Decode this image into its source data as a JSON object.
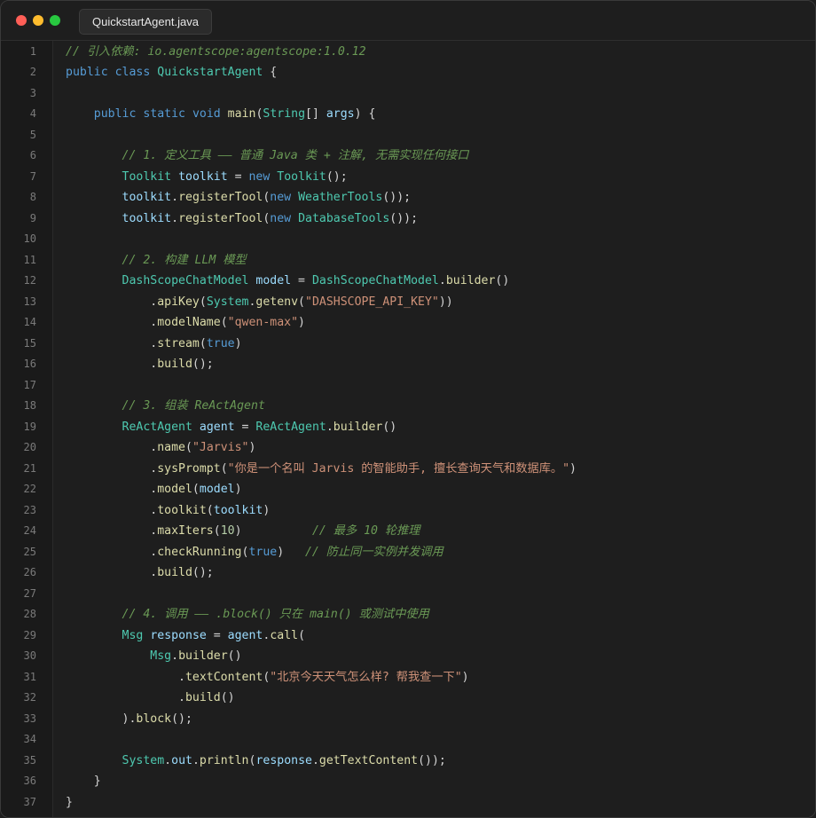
{
  "window": {
    "controls": [
      "close",
      "minimize",
      "zoom"
    ],
    "tab_label": "QuickstartAgent.java"
  },
  "editor": {
    "lines": [
      {
        "n": "1",
        "tokens": [
          {
            "t": "comment",
            "v": "// 引入依赖: io.agentscope:agentscope:1.0.12"
          }
        ]
      },
      {
        "n": "2",
        "tokens": [
          {
            "t": "keyword",
            "v": "public"
          },
          {
            "t": "plain",
            "v": " "
          },
          {
            "t": "keyword",
            "v": "class"
          },
          {
            "t": "plain",
            "v": " "
          },
          {
            "t": "type",
            "v": "QuickstartAgent"
          },
          {
            "t": "plain",
            "v": " {"
          }
        ]
      },
      {
        "n": "3",
        "tokens": []
      },
      {
        "n": "4",
        "tokens": [
          {
            "t": "plain",
            "v": "    "
          },
          {
            "t": "keyword",
            "v": "public"
          },
          {
            "t": "plain",
            "v": " "
          },
          {
            "t": "keyword",
            "v": "static"
          },
          {
            "t": "plain",
            "v": " "
          },
          {
            "t": "keyword",
            "v": "void"
          },
          {
            "t": "plain",
            "v": " "
          },
          {
            "t": "function",
            "v": "main"
          },
          {
            "t": "plain",
            "v": "("
          },
          {
            "t": "type",
            "v": "String"
          },
          {
            "t": "plain",
            "v": "[] "
          },
          {
            "t": "variable",
            "v": "args"
          },
          {
            "t": "plain",
            "v": ") {"
          }
        ]
      },
      {
        "n": "5",
        "tokens": []
      },
      {
        "n": "6",
        "tokens": [
          {
            "t": "plain",
            "v": "        "
          },
          {
            "t": "comment",
            "v": "// 1. 定义工具 —— 普通 Java 类 + 注解, 无需实现任何接口"
          }
        ]
      },
      {
        "n": "7",
        "tokens": [
          {
            "t": "plain",
            "v": "        "
          },
          {
            "t": "type",
            "v": "Toolkit"
          },
          {
            "t": "plain",
            "v": " "
          },
          {
            "t": "variable",
            "v": "toolkit"
          },
          {
            "t": "plain",
            "v": " = "
          },
          {
            "t": "keyword",
            "v": "new"
          },
          {
            "t": "plain",
            "v": " "
          },
          {
            "t": "type",
            "v": "Toolkit"
          },
          {
            "t": "plain",
            "v": "();"
          }
        ]
      },
      {
        "n": "8",
        "tokens": [
          {
            "t": "plain",
            "v": "        "
          },
          {
            "t": "variable",
            "v": "toolkit"
          },
          {
            "t": "plain",
            "v": "."
          },
          {
            "t": "function",
            "v": "registerTool"
          },
          {
            "t": "plain",
            "v": "("
          },
          {
            "t": "keyword",
            "v": "new"
          },
          {
            "t": "plain",
            "v": " "
          },
          {
            "t": "type",
            "v": "WeatherTools"
          },
          {
            "t": "plain",
            "v": "());"
          }
        ]
      },
      {
        "n": "9",
        "tokens": [
          {
            "t": "plain",
            "v": "        "
          },
          {
            "t": "variable",
            "v": "toolkit"
          },
          {
            "t": "plain",
            "v": "."
          },
          {
            "t": "function",
            "v": "registerTool"
          },
          {
            "t": "plain",
            "v": "("
          },
          {
            "t": "keyword",
            "v": "new"
          },
          {
            "t": "plain",
            "v": " "
          },
          {
            "t": "type",
            "v": "DatabaseTools"
          },
          {
            "t": "plain",
            "v": "());"
          }
        ]
      },
      {
        "n": "10",
        "tokens": []
      },
      {
        "n": "11",
        "tokens": [
          {
            "t": "plain",
            "v": "        "
          },
          {
            "t": "comment",
            "v": "// 2. 构建 LLM 模型"
          }
        ]
      },
      {
        "n": "12",
        "tokens": [
          {
            "t": "plain",
            "v": "        "
          },
          {
            "t": "type",
            "v": "DashScopeChatModel"
          },
          {
            "t": "plain",
            "v": " "
          },
          {
            "t": "variable",
            "v": "model"
          },
          {
            "t": "plain",
            "v": " = "
          },
          {
            "t": "type",
            "v": "DashScopeChatModel"
          },
          {
            "t": "plain",
            "v": "."
          },
          {
            "t": "function",
            "v": "builder"
          },
          {
            "t": "plain",
            "v": "()"
          }
        ]
      },
      {
        "n": "13",
        "tokens": [
          {
            "t": "plain",
            "v": "            ."
          },
          {
            "t": "function",
            "v": "apiKey"
          },
          {
            "t": "plain",
            "v": "("
          },
          {
            "t": "type",
            "v": "System"
          },
          {
            "t": "plain",
            "v": "."
          },
          {
            "t": "function",
            "v": "getenv"
          },
          {
            "t": "plain",
            "v": "("
          },
          {
            "t": "string",
            "v": "\"DASHSCOPE_API_KEY\""
          },
          {
            "t": "plain",
            "v": "))"
          }
        ]
      },
      {
        "n": "14",
        "tokens": [
          {
            "t": "plain",
            "v": "            ."
          },
          {
            "t": "function",
            "v": "modelName"
          },
          {
            "t": "plain",
            "v": "("
          },
          {
            "t": "string",
            "v": "\"qwen-max\""
          },
          {
            "t": "plain",
            "v": ")"
          }
        ]
      },
      {
        "n": "15",
        "tokens": [
          {
            "t": "plain",
            "v": "            ."
          },
          {
            "t": "function",
            "v": "stream"
          },
          {
            "t": "plain",
            "v": "("
          },
          {
            "t": "keyword",
            "v": "true"
          },
          {
            "t": "plain",
            "v": ")"
          }
        ]
      },
      {
        "n": "16",
        "tokens": [
          {
            "t": "plain",
            "v": "            ."
          },
          {
            "t": "function",
            "v": "build"
          },
          {
            "t": "plain",
            "v": "();"
          }
        ]
      },
      {
        "n": "17",
        "tokens": []
      },
      {
        "n": "18",
        "tokens": [
          {
            "t": "plain",
            "v": "        "
          },
          {
            "t": "comment",
            "v": "// 3. 组装 ReActAgent"
          }
        ]
      },
      {
        "n": "19",
        "tokens": [
          {
            "t": "plain",
            "v": "        "
          },
          {
            "t": "type",
            "v": "ReActAgent"
          },
          {
            "t": "plain",
            "v": " "
          },
          {
            "t": "variable",
            "v": "agent"
          },
          {
            "t": "plain",
            "v": " = "
          },
          {
            "t": "type",
            "v": "ReActAgent"
          },
          {
            "t": "plain",
            "v": "."
          },
          {
            "t": "function",
            "v": "builder"
          },
          {
            "t": "plain",
            "v": "()"
          }
        ]
      },
      {
        "n": "20",
        "tokens": [
          {
            "t": "plain",
            "v": "            ."
          },
          {
            "t": "function",
            "v": "name"
          },
          {
            "t": "plain",
            "v": "("
          },
          {
            "t": "string",
            "v": "\"Jarvis\""
          },
          {
            "t": "plain",
            "v": ")"
          }
        ]
      },
      {
        "n": "21",
        "tokens": [
          {
            "t": "plain",
            "v": "            ."
          },
          {
            "t": "function",
            "v": "sysPrompt"
          },
          {
            "t": "plain",
            "v": "("
          },
          {
            "t": "string",
            "v": "\"你是一个名叫 Jarvis 的智能助手, 擅长查询天气和数据库。\""
          },
          {
            "t": "plain",
            "v": ")"
          }
        ]
      },
      {
        "n": "22",
        "tokens": [
          {
            "t": "plain",
            "v": "            ."
          },
          {
            "t": "function",
            "v": "model"
          },
          {
            "t": "plain",
            "v": "("
          },
          {
            "t": "variable",
            "v": "model"
          },
          {
            "t": "plain",
            "v": ")"
          }
        ]
      },
      {
        "n": "23",
        "tokens": [
          {
            "t": "plain",
            "v": "            ."
          },
          {
            "t": "function",
            "v": "toolkit"
          },
          {
            "t": "plain",
            "v": "("
          },
          {
            "t": "variable",
            "v": "toolkit"
          },
          {
            "t": "plain",
            "v": ")"
          }
        ]
      },
      {
        "n": "24",
        "tokens": [
          {
            "t": "plain",
            "v": "            ."
          },
          {
            "t": "function",
            "v": "maxIters"
          },
          {
            "t": "plain",
            "v": "("
          },
          {
            "t": "number",
            "v": "10"
          },
          {
            "t": "plain",
            "v": ")          "
          },
          {
            "t": "comment",
            "v": "// 最多 10 轮推理"
          }
        ]
      },
      {
        "n": "25",
        "tokens": [
          {
            "t": "plain",
            "v": "            ."
          },
          {
            "t": "function",
            "v": "checkRunning"
          },
          {
            "t": "plain",
            "v": "("
          },
          {
            "t": "keyword",
            "v": "true"
          },
          {
            "t": "plain",
            "v": ")   "
          },
          {
            "t": "comment",
            "v": "// 防止同一实例并发调用"
          }
        ]
      },
      {
        "n": "26",
        "tokens": [
          {
            "t": "plain",
            "v": "            ."
          },
          {
            "t": "function",
            "v": "build"
          },
          {
            "t": "plain",
            "v": "();"
          }
        ]
      },
      {
        "n": "27",
        "tokens": []
      },
      {
        "n": "28",
        "tokens": [
          {
            "t": "plain",
            "v": "        "
          },
          {
            "t": "comment",
            "v": "// 4. 调用 —— .block() 只在 main() 或测试中使用"
          }
        ]
      },
      {
        "n": "29",
        "tokens": [
          {
            "t": "plain",
            "v": "        "
          },
          {
            "t": "type",
            "v": "Msg"
          },
          {
            "t": "plain",
            "v": " "
          },
          {
            "t": "variable",
            "v": "response"
          },
          {
            "t": "plain",
            "v": " = "
          },
          {
            "t": "variable",
            "v": "agent"
          },
          {
            "t": "plain",
            "v": "."
          },
          {
            "t": "function",
            "v": "call"
          },
          {
            "t": "plain",
            "v": "("
          }
        ]
      },
      {
        "n": "30",
        "tokens": [
          {
            "t": "plain",
            "v": "            "
          },
          {
            "t": "type",
            "v": "Msg"
          },
          {
            "t": "plain",
            "v": "."
          },
          {
            "t": "function",
            "v": "builder"
          },
          {
            "t": "plain",
            "v": "()"
          }
        ]
      },
      {
        "n": "31",
        "tokens": [
          {
            "t": "plain",
            "v": "                ."
          },
          {
            "t": "function",
            "v": "textContent"
          },
          {
            "t": "plain",
            "v": "("
          },
          {
            "t": "string",
            "v": "\"北京今天天气怎么样? 帮我查一下\""
          },
          {
            "t": "plain",
            "v": ")"
          }
        ]
      },
      {
        "n": "32",
        "tokens": [
          {
            "t": "plain",
            "v": "                ."
          },
          {
            "t": "function",
            "v": "build"
          },
          {
            "t": "plain",
            "v": "()"
          }
        ]
      },
      {
        "n": "33",
        "tokens": [
          {
            "t": "plain",
            "v": "        )."
          },
          {
            "t": "function",
            "v": "block"
          },
          {
            "t": "plain",
            "v": "();"
          }
        ]
      },
      {
        "n": "34",
        "tokens": []
      },
      {
        "n": "35",
        "tokens": [
          {
            "t": "plain",
            "v": "        "
          },
          {
            "t": "type",
            "v": "System"
          },
          {
            "t": "plain",
            "v": "."
          },
          {
            "t": "variable",
            "v": "out"
          },
          {
            "t": "plain",
            "v": "."
          },
          {
            "t": "function",
            "v": "println"
          },
          {
            "t": "plain",
            "v": "("
          },
          {
            "t": "variable",
            "v": "response"
          },
          {
            "t": "plain",
            "v": "."
          },
          {
            "t": "function",
            "v": "getTextContent"
          },
          {
            "t": "plain",
            "v": "());"
          }
        ]
      },
      {
        "n": "36",
        "tokens": [
          {
            "t": "plain",
            "v": "    }"
          }
        ]
      },
      {
        "n": "37",
        "tokens": [
          {
            "t": "plain",
            "v": "}"
          }
        ]
      }
    ]
  }
}
